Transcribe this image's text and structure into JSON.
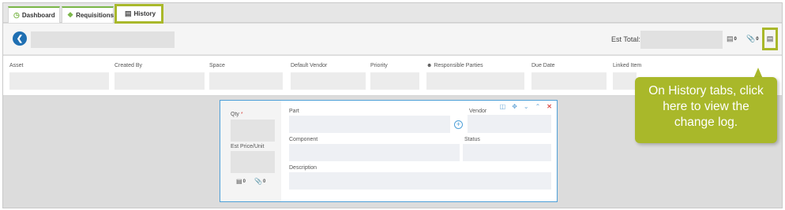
{
  "tabs": [
    {
      "label": "Dashboard",
      "icon": "gauge-icon"
    },
    {
      "label": "Requisitions",
      "icon": "tag-icon"
    },
    {
      "label": "History",
      "icon": "history-icon",
      "active": true
    }
  ],
  "header": {
    "est_total_label": "Est Total:",
    "notes_count": "0",
    "attachments_count": "0"
  },
  "fields": [
    {
      "label": "Asset"
    },
    {
      "label": "Created By"
    },
    {
      "label": "Space"
    },
    {
      "label": "Default Vendor"
    },
    {
      "label": "Priority"
    },
    {
      "label": "Responsible Parties"
    },
    {
      "label": "Due Date"
    },
    {
      "label": "Linked Item"
    }
  ],
  "card": {
    "qty_label": "Qty",
    "required_mark": "*",
    "est_price_label": "Est Price/Unit",
    "part_label": "Part",
    "vendor_label": "Vendor",
    "component_label": "Component",
    "status_label": "Status",
    "description_label": "Description",
    "notes_count": "0",
    "attachments_count": "0"
  },
  "callout": {
    "text": "On History tabs, click here to view the change log."
  },
  "colors": {
    "highlight": "#a9b82a",
    "tab_accent": "#7ab648",
    "back_button": "#1f6fb2",
    "card_border": "#4ea0d8"
  }
}
